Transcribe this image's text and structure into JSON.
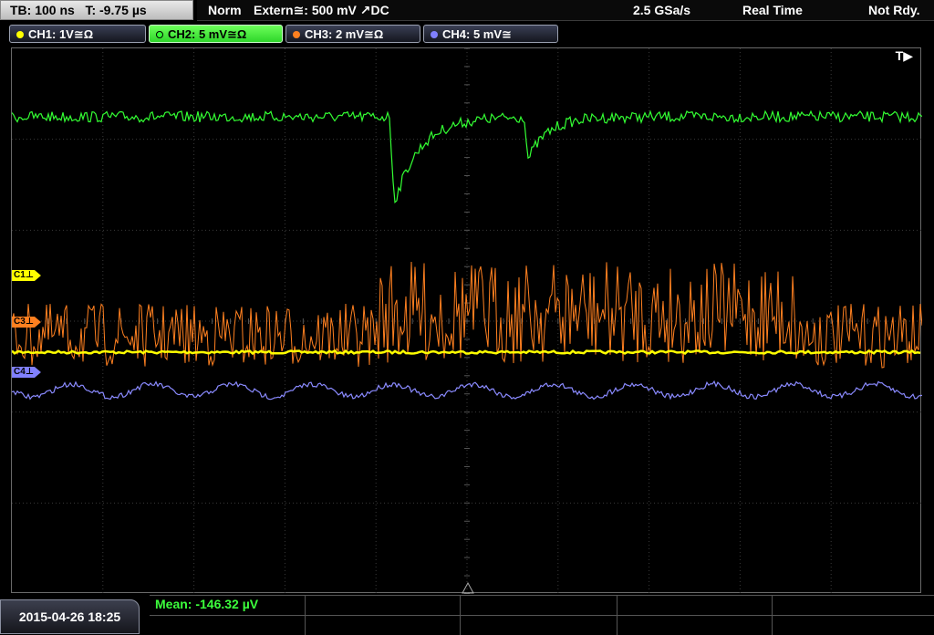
{
  "header": {
    "timebase": "TB: 100 ns   T: -9.75 µs",
    "mode": "Norm",
    "trigger": "Extern≅: 500 mV ↗DC",
    "sample_rate": "2.5 GSa/s",
    "acq_mode": "Real Time",
    "status": "Not Rdy."
  },
  "channels": [
    {
      "label": "CH1: 1V≅Ω",
      "color": "#ffff00"
    },
    {
      "label": "CH2: 5 mV≅Ω",
      "color": "#33ff33"
    },
    {
      "label": "CH3: 2 mV≅Ω",
      "color": "#ff8020"
    },
    {
      "label": "CH4: 5 mV≅",
      "color": "#8080ff"
    }
  ],
  "markers": {
    "c1": "C1⊥",
    "c3": "C3⊥",
    "c4": "C4⊥"
  },
  "trigger_tag": "T▶",
  "footer": {
    "datetime": "2015-04-26 18:25",
    "measurement": "Mean: -146.32 µV"
  }
}
